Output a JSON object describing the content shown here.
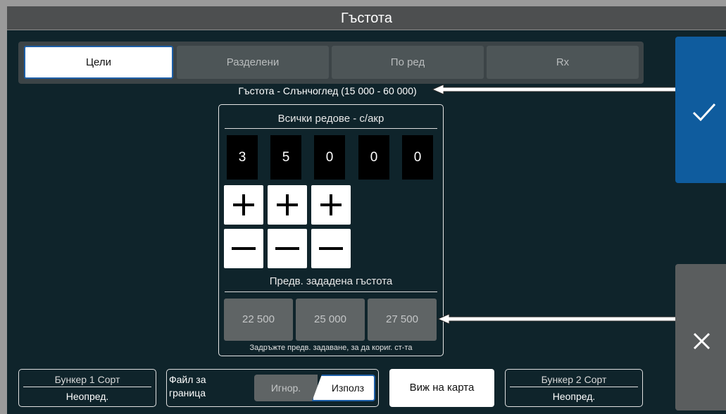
{
  "window": {
    "title": "Гъстота"
  },
  "tabs": [
    {
      "label": "Цели",
      "active": true
    },
    {
      "label": "Разделени",
      "active": false
    },
    {
      "label": "По ред",
      "active": false
    },
    {
      "label": "Rx",
      "active": false
    }
  ],
  "range_label": "Гъстота - Слънчоглед (15 000 - 60 000)",
  "panel": {
    "title": "Всички редове - с/акр",
    "digits": [
      "3",
      "5",
      "0",
      "0",
      "0"
    ],
    "preset_title": "Предв. зададена гъстота",
    "presets": [
      "22 500",
      "25 000",
      "27 500"
    ],
    "hint": "Задръжте предв. задаване, за да кориг. ст-та"
  },
  "actions": {
    "confirm_icon": "check-icon",
    "cancel_icon": "close-icon"
  },
  "bottom": {
    "bin1": {
      "title": "Бункер 1 Сорт",
      "value": "Неопред."
    },
    "file": {
      "label": "Файл за граница",
      "ignore": "Игнор.",
      "use": "Използ",
      "selected": "Използ"
    },
    "map_button": "Виж на карта",
    "bin2": {
      "title": "Бункер 2 Сорт",
      "value": "Неопред."
    }
  },
  "colors": {
    "background": "#0f242b",
    "accent": "#0f5c9e",
    "selected_border": "#1d5fa8"
  }
}
